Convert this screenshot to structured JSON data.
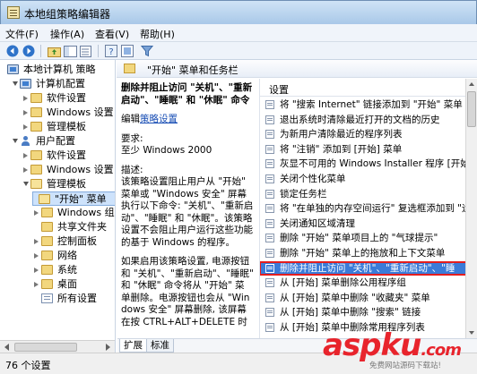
{
  "window": {
    "title": "本地组策略编辑器"
  },
  "menu": [
    "文件(F)",
    "操作(A)",
    "查看(V)",
    "帮助(H)"
  ],
  "toolbar": {
    "icons": [
      "back-icon",
      "forward-icon",
      "up-folder-icon",
      "show-hide-tree-icon",
      "export-list-icon",
      "help-icon",
      "properties-icon",
      "filter-icon"
    ]
  },
  "tree": {
    "root": "本地计算机 策略",
    "computer": "计算机配置",
    "computer_children": [
      "软件设置",
      "Windows 设置",
      "管理模板"
    ],
    "user": "用户配置",
    "user_children": [
      "软件设置",
      "Windows 设置",
      "管理模板"
    ],
    "admin_children": [
      "\"开始\" 菜单",
      "Windows 组",
      "共享文件夹",
      "控制面板",
      "网络",
      "系统",
      "桌面",
      "所有设置"
    ]
  },
  "content_header": "\"开始\" 菜单和任务栏",
  "description": {
    "title": "删除并阻止访问 \"关机\"、\"重新启动\"、\"睡眠\" 和 \"休眠\" 命令",
    "edit_prefix": "编辑",
    "edit_link": "策略设置",
    "requirements_label": "要求:",
    "requirements_value": "至少 Windows 2000",
    "desc_label": "描述:",
    "desc_text": "该策略设置阻止用户从 \"开始\" 菜单或 \"Windows 安全\" 屏幕执行以下命令: \"关机\"、\"重新启动\"、\"睡眠\" 和 \"休眠\"。该策略设置不会阻止用户运行这些功能的基于 Windows 的程序。",
    "desc_text2": "如果启用该策略设置, 电源按钮和 \"关机\"、\"重新启动\"、\"睡眠\" 和 \"休眠\" 命令将从 \"开始\" 菜单删除。电源按钮也会从 \"Windows 安全\" 屏幕删除, 该屏幕在按 CTRL+ALT+DELETE 时"
  },
  "list": {
    "header": "设置",
    "items": [
      "将 \"搜索 Internet\" 链接添加到 \"开始\" 菜单",
      "退出系统时清除最近打开的文档的历史",
      "为新用户清除最近的程序列表",
      "将 \"注销\" 添加到 [开始] 菜单",
      "灰显不可用的 Windows Installer 程序 [开始] 菜",
      "关闭个性化菜单",
      "锁定任务栏",
      "将 \"在单独的内存空间运行\" 复选框添加到 \"运行",
      "关闭通知区域清理",
      "删除 \"开始\" 菜单项目上的 \"气球提示\"",
      "删除 \"开始\" 菜单上的拖放和上下文菜单",
      "删除并阻止访问 \"关机\"、\"重新启动\"、\"睡",
      "从 [开始] 菜单删除公用程序组",
      "从 [开始] 菜单中删除 \"收藏夹\" 菜单",
      "从 [开始] 菜单中删除 \"搜索\" 链接",
      "从 [开始] 菜单中删除常用程序列表"
    ],
    "selected_index": 11
  },
  "tabs": [
    "扩展",
    "标准"
  ],
  "status": "76 个设置",
  "watermark": {
    "brand": "aspku",
    "suffix": ".com",
    "tagline": "免费网站源码下载站!"
  },
  "colors": {
    "selection": "#3b7bd8",
    "highlight_outline": "#e41e1e",
    "watermark": "#e8242c"
  }
}
